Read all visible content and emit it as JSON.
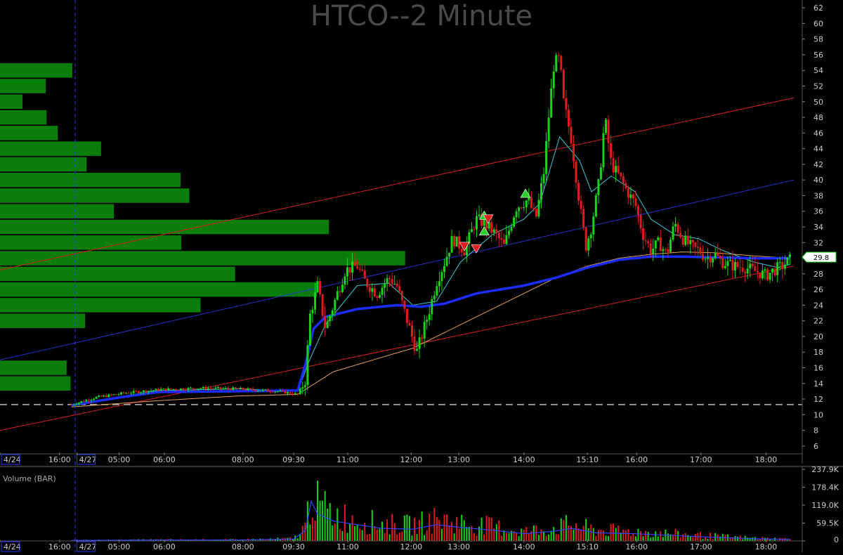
{
  "title": "HTCO--2 Minute",
  "volume_label": "Volume (BAR)",
  "last_price_label": "29.8",
  "colors": {
    "background": "#000000",
    "up": "#18d318",
    "down": "#e01b1b",
    "vwap": "#1a2cff",
    "ema_fast": "#39c6d6",
    "ema_slow": "#e3a05a",
    "profile": "#0b7d0b",
    "trend_red": "#d42020",
    "trend_blue": "#2233cc",
    "grid": "#3a3a3a",
    "axis_text": "#cccccc",
    "title": "#4a4a4a"
  },
  "chart_data": [
    {
      "type": "candlestick",
      "title": "HTCO--2 Minute",
      "ylim": [
        5,
        63
      ],
      "y_ticks": [
        6,
        8,
        10,
        12,
        14,
        16,
        18,
        20,
        22,
        24,
        26,
        28,
        30,
        32,
        34,
        36,
        38,
        40,
        42,
        44,
        46,
        48,
        50,
        52,
        54,
        56,
        58,
        60,
        62
      ],
      "x_ticks": [
        {
          "label": "4/24",
          "boxed": true,
          "pos": 0.0
        },
        {
          "label": "16:00",
          "pos": 0.075
        },
        {
          "label": "4/27",
          "boxed": true,
          "pos": 0.097
        },
        {
          "label": "05:00",
          "pos": 0.15
        },
        {
          "label": "06:00",
          "pos": 0.207
        },
        {
          "label": "08:00",
          "pos": 0.306
        },
        {
          "label": "09:30",
          "pos": 0.37
        },
        {
          "label": "11:00",
          "pos": 0.438
        },
        {
          "label": "12:00",
          "pos": 0.518
        },
        {
          "label": "13:00",
          "pos": 0.578
        },
        {
          "label": "14:00",
          "pos": 0.66
        },
        {
          "label": "15:10",
          "pos": 0.74
        },
        {
          "label": "16:00",
          "pos": 0.802
        },
        {
          "label": "17:00",
          "pos": 0.883
        },
        {
          "label": "18:00",
          "pos": 0.965
        }
      ],
      "price_path": [
        [
          0.09,
          11.3
        ],
        [
          0.12,
          12.2
        ],
        [
          0.16,
          12.8
        ],
        [
          0.2,
          13.2
        ],
        [
          0.25,
          13.4
        ],
        [
          0.3,
          13.3
        ],
        [
          0.35,
          13.0
        ],
        [
          0.375,
          12.6
        ],
        [
          0.385,
          14.5
        ],
        [
          0.39,
          22.5
        ],
        [
          0.4,
          26.5
        ],
        [
          0.41,
          21.0
        ],
        [
          0.42,
          24.0
        ],
        [
          0.435,
          28.5
        ],
        [
          0.45,
          29.0
        ],
        [
          0.46,
          27.0
        ],
        [
          0.475,
          25.5
        ],
        [
          0.49,
          27.5
        ],
        [
          0.5,
          26.5
        ],
        [
          0.51,
          23.0
        ],
        [
          0.525,
          18.0
        ],
        [
          0.54,
          23.0
        ],
        [
          0.55,
          27.0
        ],
        [
          0.56,
          29.5
        ],
        [
          0.57,
          32.5
        ],
        [
          0.585,
          31.0
        ],
        [
          0.6,
          35.0
        ],
        [
          0.61,
          34.5
        ],
        [
          0.625,
          33.0
        ],
        [
          0.635,
          31.5
        ],
        [
          0.65,
          36.5
        ],
        [
          0.665,
          37.5
        ],
        [
          0.675,
          35.0
        ],
        [
          0.685,
          41.0
        ],
        [
          0.692,
          49.0
        ],
        [
          0.698,
          55.0
        ],
        [
          0.705,
          55.5
        ],
        [
          0.71,
          50.0
        ],
        [
          0.72,
          45.0
        ],
        [
          0.73,
          37.0
        ],
        [
          0.738,
          31.5
        ],
        [
          0.745,
          34.0
        ],
        [
          0.755,
          40.0
        ],
        [
          0.762,
          48.0
        ],
        [
          0.77,
          42.0
        ],
        [
          0.78,
          40.5
        ],
        [
          0.79,
          38.5
        ],
        [
          0.8,
          37.0
        ],
        [
          0.81,
          33.0
        ],
        [
          0.82,
          31.0
        ],
        [
          0.83,
          32.0
        ],
        [
          0.84,
          30.5
        ],
        [
          0.85,
          34.5
        ],
        [
          0.86,
          32.5
        ],
        [
          0.87,
          31.5
        ],
        [
          0.88,
          31.0
        ],
        [
          0.89,
          30.0
        ],
        [
          0.9,
          30.5
        ],
        [
          0.91,
          29.5
        ],
        [
          0.925,
          29.0
        ],
        [
          0.94,
          28.8
        ],
        [
          0.955,
          28.2
        ],
        [
          0.965,
          27.8
        ],
        [
          0.975,
          28.5
        ],
        [
          0.985,
          29.0
        ],
        [
          0.995,
          29.8
        ]
      ],
      "ema_fast_path": [
        [
          0.09,
          11.3
        ],
        [
          0.2,
          13.1
        ],
        [
          0.3,
          13.3
        ],
        [
          0.375,
          13.0
        ],
        [
          0.39,
          17.0
        ],
        [
          0.41,
          21.5
        ],
        [
          0.45,
          26.5
        ],
        [
          0.49,
          26.8
        ],
        [
          0.52,
          24.0
        ],
        [
          0.55,
          24.5
        ],
        [
          0.58,
          29.5
        ],
        [
          0.62,
          33.0
        ],
        [
          0.66,
          35.0
        ],
        [
          0.68,
          37.0
        ],
        [
          0.705,
          45.5
        ],
        [
          0.73,
          42.5
        ],
        [
          0.745,
          38.5
        ],
        [
          0.77,
          40.5
        ],
        [
          0.8,
          38.5
        ],
        [
          0.82,
          35.0
        ],
        [
          0.85,
          33.0
        ],
        [
          0.88,
          32.5
        ],
        [
          0.91,
          31.0
        ],
        [
          0.95,
          29.5
        ],
        [
          0.98,
          28.8
        ],
        [
          0.995,
          29.2
        ]
      ],
      "ema_slow_path": [
        [
          0.09,
          11.0
        ],
        [
          0.2,
          11.8
        ],
        [
          0.3,
          12.4
        ],
        [
          0.375,
          12.6
        ],
        [
          0.42,
          15.5
        ],
        [
          0.47,
          17.0
        ],
        [
          0.52,
          18.5
        ],
        [
          0.58,
          21.5
        ],
        [
          0.64,
          24.5
        ],
        [
          0.7,
          27.5
        ],
        [
          0.74,
          29.0
        ],
        [
          0.78,
          30.0
        ],
        [
          0.82,
          30.5
        ],
        [
          0.86,
          30.8
        ],
        [
          0.9,
          30.7
        ],
        [
          0.95,
          30.3
        ],
        [
          0.995,
          30.0
        ]
      ],
      "vwap_path": [
        [
          0.09,
          11.2
        ],
        [
          0.15,
          12.2
        ],
        [
          0.2,
          12.9
        ],
        [
          0.3,
          13.0
        ],
        [
          0.375,
          13.1
        ],
        [
          0.385,
          16.5
        ],
        [
          0.395,
          21.0
        ],
        [
          0.41,
          22.5
        ],
        [
          0.45,
          23.5
        ],
        [
          0.5,
          24.0
        ],
        [
          0.53,
          23.8
        ],
        [
          0.56,
          24.2
        ],
        [
          0.6,
          25.5
        ],
        [
          0.66,
          26.5
        ],
        [
          0.7,
          27.5
        ],
        [
          0.74,
          28.8
        ],
        [
          0.78,
          29.8
        ],
        [
          0.82,
          30.2
        ],
        [
          0.86,
          30.2
        ],
        [
          0.9,
          30.1
        ],
        [
          0.95,
          30.0
        ],
        [
          0.995,
          30.0
        ]
      ],
      "trendlines": [
        {
          "color": "red",
          "from": [
            0.0,
            28.5
          ],
          "to": [
            1.0,
            50.5
          ]
        },
        {
          "color": "blue",
          "from": [
            0.0,
            17.0
          ],
          "to": [
            1.0,
            40.0
          ]
        },
        {
          "color": "red",
          "from": [
            0.0,
            8.0
          ],
          "to": [
            1.0,
            29.0
          ]
        }
      ],
      "reference_line": 11.3,
      "markers": [
        {
          "type": "buy",
          "x": 0.61,
          "y": 33.5
        },
        {
          "type": "buy",
          "x": 0.61,
          "y": 35.5
        },
        {
          "type": "sell",
          "x": 0.585,
          "y": 31.5
        },
        {
          "type": "sell",
          "x": 0.6,
          "y": 31.2
        },
        {
          "type": "sell",
          "x": 0.615,
          "y": 35.0
        },
        {
          "type": "buy",
          "x": 0.662,
          "y": 38.3
        }
      ],
      "volume_profile": [
        {
          "price": 54,
          "width": 0.09
        },
        {
          "price": 52,
          "width": 0.057
        },
        {
          "price": 50,
          "width": 0.028
        },
        {
          "price": 48,
          "width": 0.058
        },
        {
          "price": 46,
          "width": 0.072
        },
        {
          "price": 44,
          "width": 0.126
        },
        {
          "price": 42,
          "width": 0.108
        },
        {
          "price": 40,
          "width": 0.225
        },
        {
          "price": 38,
          "width": 0.236
        },
        {
          "price": 36,
          "width": 0.142
        },
        {
          "price": 34,
          "width": 0.41
        },
        {
          "price": 32,
          "width": 0.226
        },
        {
          "price": 30,
          "width": 0.505
        },
        {
          "price": 28,
          "width": 0.293
        },
        {
          "price": 26,
          "width": 0.395
        },
        {
          "price": 24,
          "width": 0.25
        },
        {
          "price": 22,
          "width": 0.106
        },
        {
          "price": 20,
          "width": 0.0
        },
        {
          "price": 18,
          "width": 0.0
        },
        {
          "price": 16,
          "width": 0.083
        },
        {
          "price": 14,
          "width": 0.088
        }
      ]
    },
    {
      "type": "bar",
      "title": "Volume (BAR)",
      "ylim": [
        0,
        237900
      ],
      "y_ticks": [
        {
          "label": "237.9K",
          "value": 237900
        },
        {
          "label": "178.4K",
          "value": 178400
        },
        {
          "label": "119.0K",
          "value": 119000
        },
        {
          "label": "59.5K",
          "value": 59500
        },
        {
          "label": "0",
          "value": 0
        }
      ],
      "volume_envelope": [
        [
          0.09,
          3000
        ],
        [
          0.2,
          5000
        ],
        [
          0.3,
          5000
        ],
        [
          0.37,
          10000
        ],
        [
          0.385,
          60000
        ],
        [
          0.392,
          220000
        ],
        [
          0.4,
          150000
        ],
        [
          0.42,
          110000
        ],
        [
          0.45,
          90000
        ],
        [
          0.48,
          70000
        ],
        [
          0.52,
          65000
        ],
        [
          0.55,
          90000
        ],
        [
          0.58,
          75000
        ],
        [
          0.62,
          60000
        ],
        [
          0.66,
          40000
        ],
        [
          0.7,
          55000
        ],
        [
          0.72,
          70000
        ],
        [
          0.75,
          45000
        ],
        [
          0.8,
          40000
        ],
        [
          0.85,
          30000
        ],
        [
          0.9,
          20000
        ],
        [
          0.95,
          12000
        ],
        [
          0.995,
          8000
        ]
      ]
    }
  ]
}
